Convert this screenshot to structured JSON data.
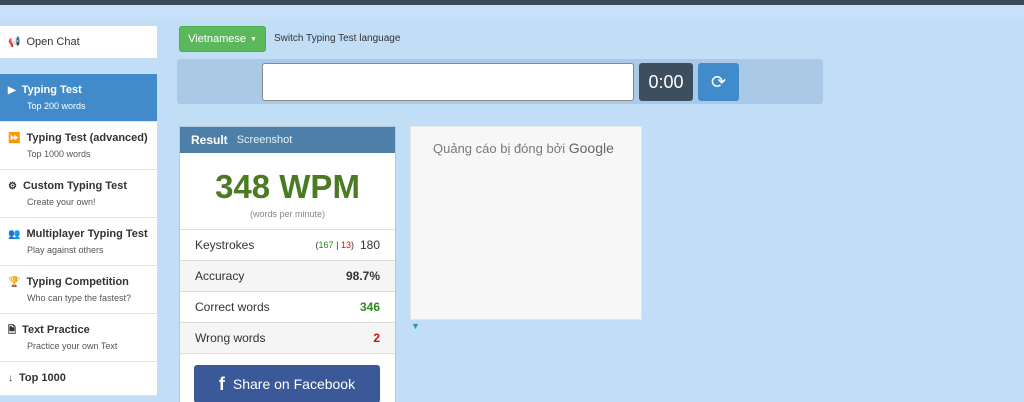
{
  "sidebar": {
    "open_chat": "Open Chat",
    "items": [
      {
        "title": "Typing Test",
        "sub": "Top 200 words",
        "icon": "play-icon",
        "glyph": "▶",
        "active": true
      },
      {
        "title": "Typing Test (advanced)",
        "sub": "Top 1000 words",
        "icon": "fast-forward-icon",
        "glyph": "⏩",
        "active": false
      },
      {
        "title": "Custom Typing Test",
        "sub": "Create your own!",
        "icon": "cogs-icon",
        "glyph": "⚙",
        "active": false
      },
      {
        "title": "Multiplayer Typing Test",
        "sub": "Play against others",
        "icon": "users-icon",
        "glyph": "👥",
        "active": false
      },
      {
        "title": "Typing Competition",
        "sub": "Who can type the fastest?",
        "icon": "trophy-icon",
        "glyph": "🏆",
        "active": false
      },
      {
        "title": "Text Practice",
        "sub": "Practice your own Text",
        "icon": "file-icon",
        "glyph": "🗎",
        "active": false
      },
      {
        "title": "Top 1000",
        "sub": "",
        "icon": "list-icon",
        "glyph": "↓",
        "active": false
      }
    ]
  },
  "language": {
    "selected": "Vietnamese",
    "hint": "Switch Typing Test language"
  },
  "typing": {
    "input_value": "",
    "timer": "0:00"
  },
  "result": {
    "title": "Result",
    "screenshot": "Screenshot",
    "wpm": "348 WPM",
    "wpm_sub": "(words per minute)",
    "keystrokes_label": "Keystrokes",
    "keystrokes_correct": "167",
    "keystrokes_sep": "|",
    "keystrokes_wrong": "13",
    "keystrokes_open": "(",
    "keystrokes_close": ")",
    "keystrokes_total": "180",
    "accuracy_label": "Accuracy",
    "accuracy_value": "98.7%",
    "correct_label": "Correct words",
    "correct_value": "346",
    "wrong_label": "Wrong words",
    "wrong_value": "2",
    "share_label": "Share on Facebook"
  },
  "ad": {
    "text": "Quảng cáo bị đóng bởi",
    "brand": "Google"
  },
  "colors": {
    "background": "#c2ddf6",
    "active": "#428bca",
    "success": "#5cb85c",
    "wpm": "#4a7a22",
    "facebook": "#3b5998"
  }
}
